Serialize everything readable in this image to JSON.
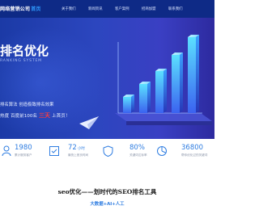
{
  "header": {
    "logo_main": "网络营销公司",
    "logo_accent": "首页",
    "nav": [
      "关于我们",
      "新闻资讯",
      "客户案例",
      "招商加盟",
      "联系我们"
    ]
  },
  "hero": {
    "title": "排名优化",
    "subtitle": "RANKING SYSTEM",
    "line1": "排名算法 创造极致排名效果",
    "line2_before": "热度 百度前100名",
    "line2_highlight": "三天",
    "line2_after": "上首页！"
  },
  "stats": [
    {
      "value": "1980",
      "unit": "",
      "label": "累计服务客户"
    },
    {
      "value": "72",
      "unit": "小时",
      "label": "最快上首页时间"
    },
    {
      "value": "80%",
      "unit": "",
      "label": "关键词达标率"
    },
    {
      "value": "36800",
      "unit": "",
      "label": "帮你优化过的关键词"
    }
  ],
  "section": {
    "title": "seo优化——划时代的SEO排名工具",
    "subtitle": "大数据+AI+人工"
  },
  "colors": {
    "header_bg": "#0e2a86",
    "hero_bg": "#2c46bf",
    "accent_blue": "#2f7de1",
    "highlight_red": "#ff3b3b"
  }
}
